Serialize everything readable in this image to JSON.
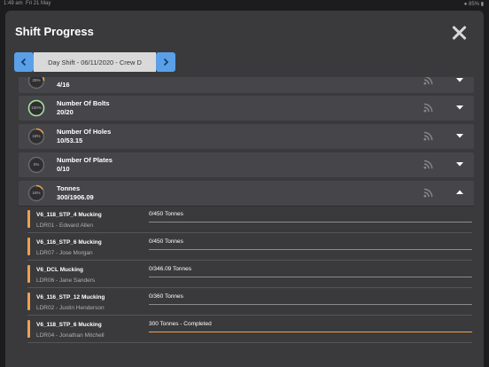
{
  "statusbar": {
    "time": "1:49 am",
    "date": "Fri 21 May",
    "battery": "85%"
  },
  "modal": {
    "title": "Shift Progress"
  },
  "shift": {
    "label": "Day Shift - 06/11/2020 - Crew D"
  },
  "colors": {
    "accent": "#5aa0e8",
    "progress": "#f0a050",
    "complete_ring": "#a6e09a"
  },
  "categories": [
    {
      "name": "",
      "value": "4/16",
      "percent_label": "25%",
      "fraction": 0.25,
      "expanded": false
    },
    {
      "name": "Number Of Bolts",
      "value": "20/20",
      "percent_label": "100%",
      "fraction": 1.0,
      "expanded": false
    },
    {
      "name": "Number Of Holes",
      "value": "10/53.15",
      "percent_label": "18%",
      "fraction": 0.18,
      "expanded": false
    },
    {
      "name": "Number Of Plates",
      "value": "0/10",
      "percent_label": "0%",
      "fraction": 0.0,
      "expanded": false
    },
    {
      "name": "Tonnes",
      "value": "300/1906.09",
      "percent_label": "16%",
      "fraction": 0.16,
      "expanded": true
    }
  ],
  "tasks": [
    {
      "name": "V6_118_STP_4 Mucking",
      "operator": "LDR01 - Edward Allen",
      "progress": "0/450 Tonnes",
      "fraction": 0.0
    },
    {
      "name": "V6_116_STP_6 Mucking",
      "operator": "LDR07 - Jose Morgan",
      "progress": "0/450 Tonnes",
      "fraction": 0.0
    },
    {
      "name": "V6_DCL Mucking",
      "operator": "LDR06 - Jane Sanders",
      "progress": "0/346.09 Tonnes",
      "fraction": 0.0
    },
    {
      "name": "V6_116_STP_12 Mucking",
      "operator": "LDR02 - Justin Henderson",
      "progress": "0/360 Tonnes",
      "fraction": 0.0
    },
    {
      "name": "V6_118_STP_6 Mucking",
      "operator": "LDR04 - Jonathan Mitchell",
      "progress": "300 Tonnes - Completed",
      "fraction": 1.0
    }
  ]
}
